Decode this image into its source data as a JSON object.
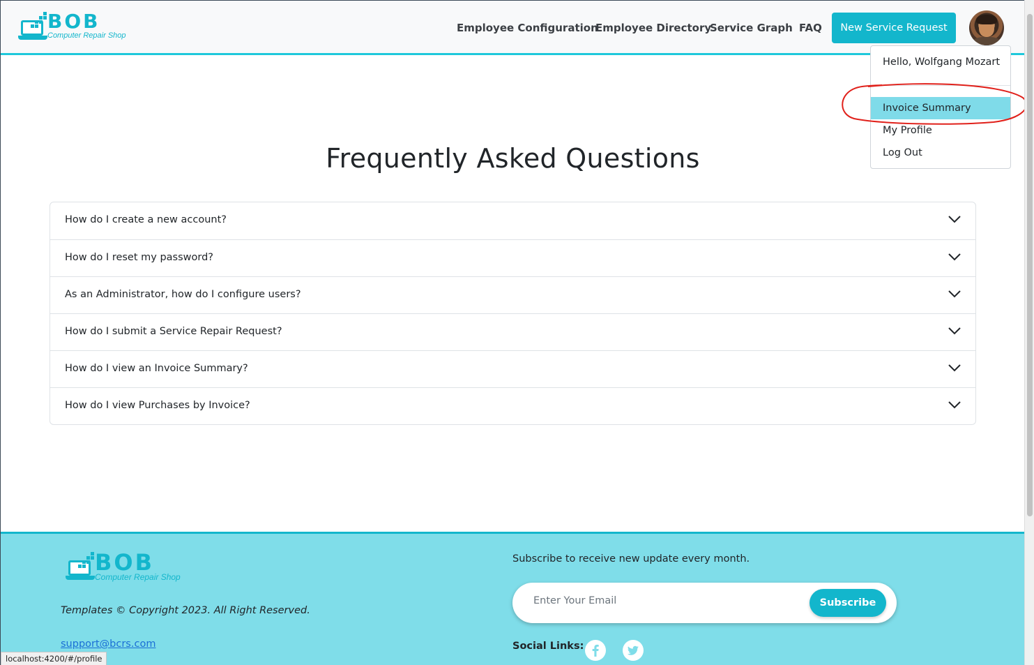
{
  "brand": {
    "name": "BOB",
    "tagline": "Computer Repair Shop"
  },
  "nav": {
    "items": [
      {
        "label": "Employee Configuration"
      },
      {
        "label": "Employee Directory"
      },
      {
        "label": "Service Graph"
      },
      {
        "label": "FAQ"
      }
    ],
    "new_request_label": "New Service Request"
  },
  "user_menu": {
    "greeting": "Hello, Wolfgang Mozart",
    "items": [
      {
        "label": "Invoice Summary",
        "highlighted": true
      },
      {
        "label": "My Profile"
      },
      {
        "label": "Log Out"
      }
    ]
  },
  "faq": {
    "title": "Frequently Asked Questions",
    "questions": [
      "How do I create a new account?",
      "How do I reset my password?",
      "As an Administrator, how do I configure users?",
      "How do I submit a Service Repair Request?",
      "How do I view an Invoice Summary?",
      "How do I view Purchases by Invoice?"
    ]
  },
  "footer": {
    "copyright": "Templates © Copyright 2023. All Right Reserved.",
    "support_email": "support@bcrs.com",
    "subscribe_text": "Subscribe to receive new update every month.",
    "email_placeholder": "Enter Your Email",
    "subscribe_button": "Subscribe",
    "social_label": "Social Links:",
    "social_icons": [
      "facebook-icon",
      "twitter-icon"
    ]
  },
  "status_bar": {
    "url": "localhost:4200/#/profile"
  },
  "colors": {
    "accent": "#13b6cc",
    "footer_bg": "#7fdde9",
    "highlight": "#7fdbe9",
    "annotation": "#e0201a"
  }
}
